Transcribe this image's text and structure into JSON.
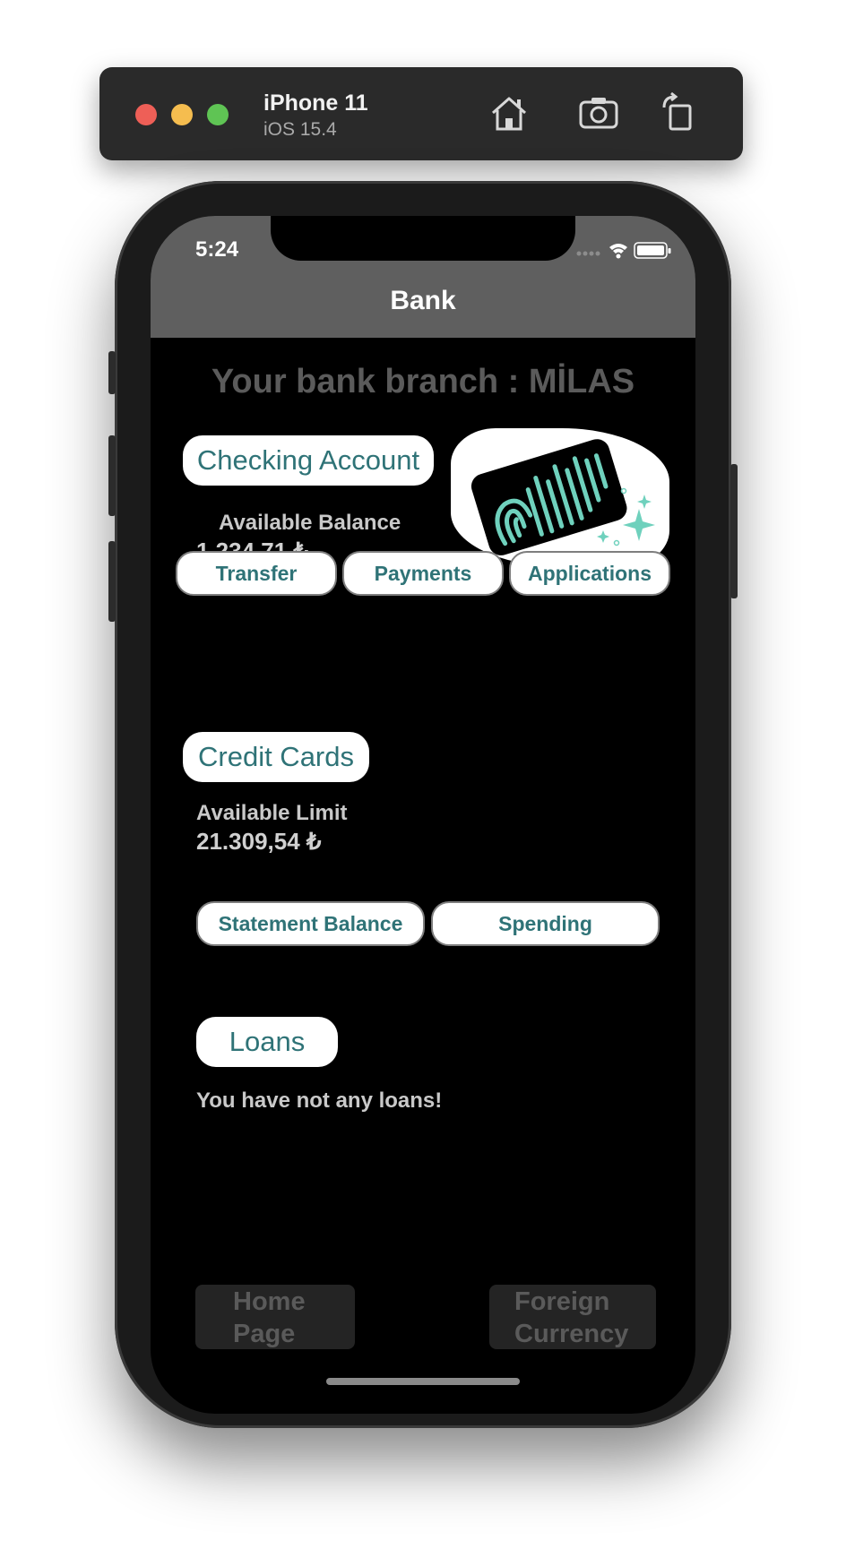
{
  "simulator": {
    "device_name": "iPhone 11",
    "os_version": "iOS 15.4",
    "icons": [
      "home-icon",
      "screenshot-icon",
      "rotate-icon"
    ]
  },
  "status_bar": {
    "time": "5:24",
    "icons": [
      "signal-icon",
      "wifi-icon",
      "battery-icon"
    ]
  },
  "nav": {
    "title": "Bank"
  },
  "branch_text": "Your bank branch : MİLAS",
  "checking": {
    "title": "Checking Account",
    "balance_label": "Available Balance",
    "balance_value": "1.234,71 ₺",
    "actions": [
      "Transfer",
      "Payments",
      "Applications"
    ]
  },
  "credit_cards": {
    "title": "Credit Cards",
    "limit_label": "Available Limit",
    "limit_value": "21.309,54 ₺",
    "actions": [
      "Statement Balance",
      "Spending"
    ]
  },
  "loans": {
    "title": "Loans",
    "message": "You have not any loans!"
  },
  "bottom_tabs": {
    "home_line1": "Home",
    "home_line2": "Page",
    "foreign_line1": "Foreign",
    "foreign_line2": "Currency"
  },
  "colors": {
    "accent_text": "#2f7377",
    "card_pattern": "#6fd1bd",
    "nav_bg": "#5f5f5f"
  }
}
